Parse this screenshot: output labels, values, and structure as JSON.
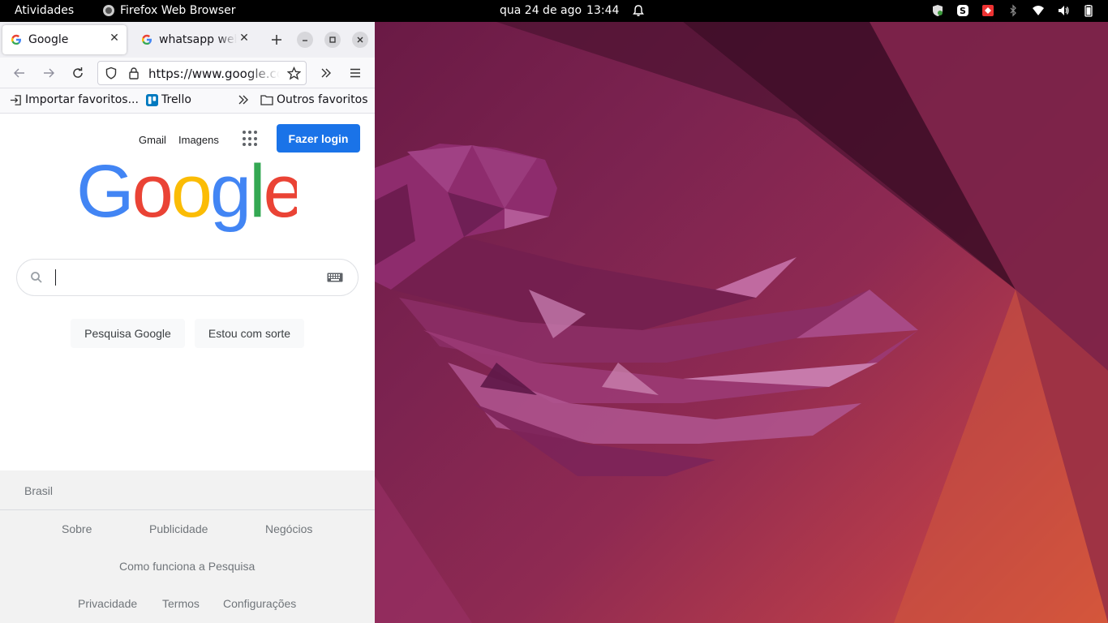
{
  "topbar": {
    "activities": "Atividades",
    "app_name": "Firefox Web Browser",
    "date": "qua 24 de ago",
    "time": "13:44"
  },
  "browser": {
    "tabs": [
      {
        "title": "Google",
        "favicon": "google-icon"
      },
      {
        "title": "whatsapp web",
        "favicon": "google-icon"
      }
    ],
    "url": "https://www.google.com",
    "bookmarks": [
      {
        "label": "Importar favoritos...",
        "icon": "import-icon"
      },
      {
        "label": "Trello",
        "icon": "trello-icon"
      },
      {
        "label": "Outros favoritos",
        "icon": "folder-icon"
      }
    ]
  },
  "google": {
    "links": {
      "gmail": "Gmail",
      "images": "Imagens"
    },
    "login": "Fazer login",
    "search_button": "Pesquisa Google",
    "lucky_button": "Estou com sorte",
    "footer": {
      "country": "Brasil",
      "links": [
        "Sobre",
        "Publicidade",
        "Negócios",
        "Como funciona a Pesquisa",
        "Privacidade",
        "Termos",
        "Configurações"
      ]
    }
  },
  "colors": {
    "google_blue": "#4285f4",
    "google_red": "#ea4335",
    "google_yellow": "#fbbc05",
    "google_green": "#34a853",
    "login_button": "#1a73e8"
  }
}
